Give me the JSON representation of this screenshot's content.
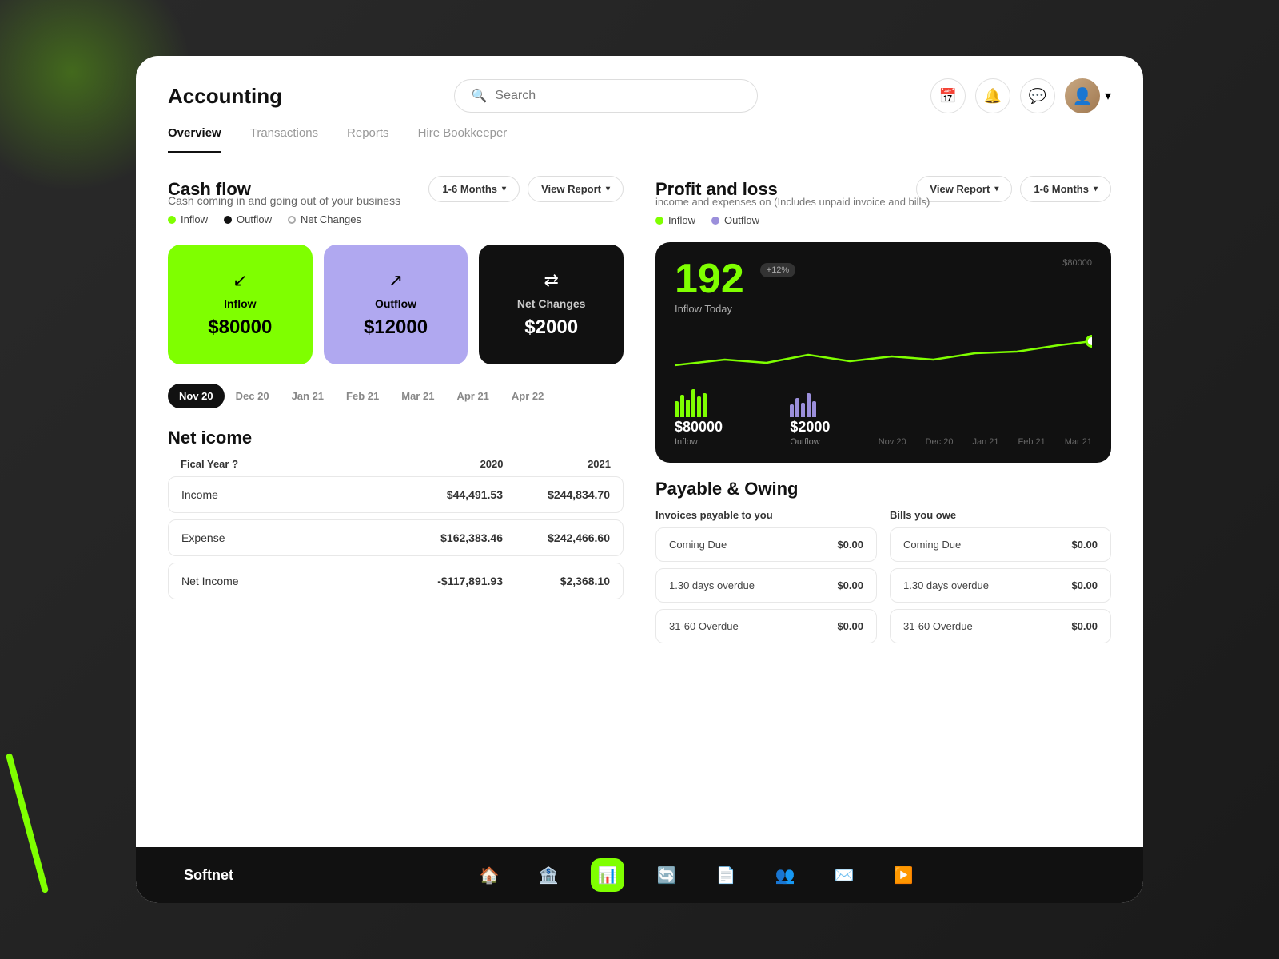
{
  "app": {
    "title": "Accounting",
    "brand": "Softnet"
  },
  "search": {
    "placeholder": "Search"
  },
  "nav": {
    "items": [
      "Overview",
      "Transactions",
      "Reports",
      "Hire Bookkeeper"
    ],
    "active": "Overview"
  },
  "cashflow": {
    "title": "Cash flow",
    "description": "Cash coming in and going out of your business",
    "period_btn": "1-6 Months",
    "report_btn": "View Report",
    "legend": {
      "inflow": "Inflow",
      "outflow": "Outflow",
      "net_changes": "Net Changes"
    },
    "cards": {
      "inflow_label": "Inflow",
      "inflow_value": "$80000",
      "outflow_label": "Outflow",
      "outflow_value": "$12000",
      "net_label": "Net Changes",
      "net_value": "$2000"
    },
    "timeline": [
      "Nov 20",
      "Dec 20",
      "Jan 21",
      "Feb 21",
      "Mar 21",
      "Apr 21",
      "Apr 22"
    ],
    "timeline_active": "Nov 20"
  },
  "net_income": {
    "title": "Net icome",
    "fiscal_year_label": "Fical Year ?",
    "col_2020": "2020",
    "col_2021": "2021",
    "rows": [
      {
        "label": "Income",
        "v2020": "$44,491.53",
        "v2021": "$244,834.70"
      },
      {
        "label": "Expense",
        "v2020": "$162,383.46",
        "v2021": "$242,466.60"
      },
      {
        "label": "Net Income",
        "v2020": "-$117,891.93",
        "v2021": "$2,368.10"
      }
    ]
  },
  "profit_loss": {
    "title": "Profit and loss",
    "description": "income and expenses on (Includes unpaid invoice and bills)",
    "report_btn": "View Report",
    "period_btn": "1-6 Months",
    "legend": {
      "inflow": "Inflow",
      "outflow": "Outflow"
    },
    "chart": {
      "main_value": "192",
      "badge": "+12%",
      "label": "Inflow Today",
      "y_label": "$80000",
      "inflow_stat_value": "$80000",
      "inflow_stat_label": "Inflow",
      "outflow_stat_value": "$2000",
      "outflow_stat_label": "Outflow",
      "months": [
        "Nov 20",
        "Dec 20",
        "Jan 21",
        "Feb 21",
        "Mar 21"
      ]
    }
  },
  "payable": {
    "title": "Payable & Owing",
    "col1_header": "Invoices payable to you",
    "col2_header": "Bills you owe",
    "rows": [
      {
        "col1_label": "Coming Due",
        "col1_amount": "$0.00",
        "col2_label": "Coming Due",
        "col2_amount": "$0.00"
      },
      {
        "col1_label": "1.30 days overdue",
        "col1_amount": "$0.00",
        "col2_label": "1.30 days overdue",
        "col2_amount": "$0.00"
      },
      {
        "col1_label": "31-60 Overdue",
        "col1_amount": "$0.00",
        "col2_label": "31-60 Overdue",
        "col2_amount": "$0.00"
      }
    ]
  },
  "bottom_nav": {
    "icons": [
      "🏠",
      "🏦",
      "📊",
      "🔄",
      "📄",
      "👥",
      "✉️",
      "▶️"
    ],
    "active_index": 2
  },
  "icons": {
    "search": "🔍",
    "calendar": "📅",
    "bell": "🔔",
    "chat": "💬",
    "chevron_down": "▾",
    "inflow_arrow": "↙",
    "outflow_arrow": "↗",
    "net_arrow": "⇄"
  }
}
